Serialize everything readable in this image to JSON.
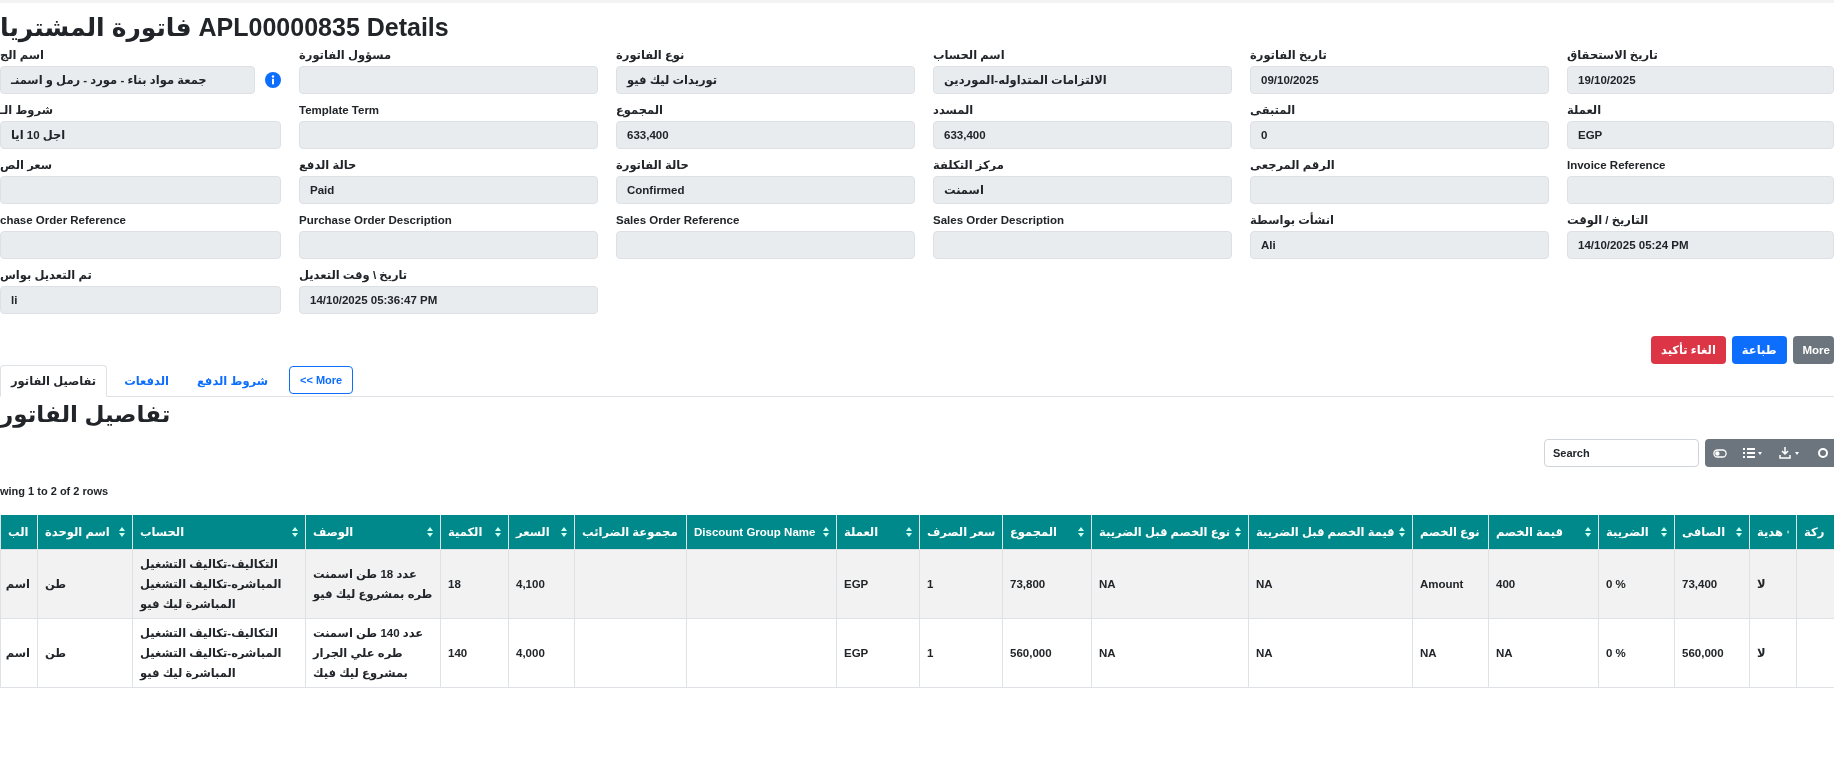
{
  "title": "فاتورة المشتريا APL00000835 Details",
  "form_rows": [
    [
      {
        "label": "تاريخ الاستحقاق",
        "value": "19/10/2025",
        "kind": "text"
      },
      {
        "label": "تاريخ الفاتورة",
        "value": "09/10/2025",
        "kind": "text"
      },
      {
        "label": "اسم الحساب",
        "value": "الالتزامات المتداوله-الموردين",
        "kind": "text"
      },
      {
        "label": "نوع الفاتورة",
        "value": "توريدات ليك فيو",
        "kind": "text"
      },
      {
        "label": "مسؤول الفاتورة",
        "kind": "text"
      },
      {
        "label": "اسم الج",
        "value": "جمعة مواد بناء - مورد - رمل و اسمنـ",
        "kind": "info"
      }
    ],
    [
      {
        "label": "العملة",
        "value": "EGP",
        "kind": "text"
      },
      {
        "label": "المتبقى",
        "value": "0",
        "kind": "text"
      },
      {
        "label": "المسدد",
        "value": "633,400",
        "kind": "text"
      },
      {
        "label": "المجموع",
        "value": "633,400",
        "kind": "text"
      },
      {
        "label": "Template Term",
        "kind": "text"
      },
      {
        "label": "شروط الـ",
        "value": "اجل 10 ايا",
        "kind": "text"
      }
    ],
    [
      {
        "label": "Invoice Reference",
        "kind": "text"
      },
      {
        "label": "الرقم المرجعى",
        "kind": "text"
      },
      {
        "label": "مركز التكلفة",
        "value": "اسمنت",
        "kind": "text"
      },
      {
        "label": "حالة الفاتورة",
        "value": "Confirmed",
        "kind": "text"
      },
      {
        "label": "حالة الدفع",
        "value": "Paid",
        "kind": "text"
      },
      {
        "label": "سعر الص",
        "kind": "text"
      }
    ],
    [
      {
        "label": "التاريخ / الوقت",
        "value": "14/10/2025 05:24 PM",
        "kind": "text"
      },
      {
        "label": "انشأت بواسطة",
        "value": "Ali",
        "kind": "text"
      },
      {
        "label": "Sales Order Description",
        "kind": "text"
      },
      {
        "label": "Sales Order Reference",
        "kind": "text"
      },
      {
        "label": "Purchase Order Description",
        "kind": "text"
      },
      {
        "label": "chase Order Reference",
        "kind": "text"
      }
    ],
    [
      {
        "label": "تاريخ \\ وقت التعديل",
        "value": "14/10/2025 05:36:47 PM",
        "kind": "text"
      },
      {
        "label": "تم التعديل بواس",
        "value": "li",
        "kind": "text"
      }
    ]
  ],
  "actions": [
    {
      "label": "More",
      "kind": "secondary"
    },
    {
      "label": "طباعة",
      "kind": "primary"
    },
    {
      "label": "الغاء تأكيد",
      "kind": "danger"
    }
  ],
  "tabs": [
    {
      "label": "More >>",
      "kind": "more",
      "selected": false
    },
    {
      "label": "شروط الدفع",
      "kind": "tab",
      "selected": false
    },
    {
      "label": "الدفعات",
      "kind": "tab",
      "selected": false
    },
    {
      "label": "تفاصيل الفاتور",
      "kind": "tab",
      "selected": true
    }
  ],
  "section_heading": "تفاصيل الفاتور",
  "search": {
    "placeholder": "Search"
  },
  "rows_info": "wing 1 to 2 of 2 rows",
  "table": {
    "columns": [
      "ركة",
      "هدية",
      "الصافى",
      "الضريبة",
      "قيمة الخصم",
      "نوع الخصم",
      "قيمة الخصم قبل الضريبة",
      "نوع الخصم قبل الضريبة",
      "المجموع",
      "سعر الصرف",
      "العملة",
      "Discount Group Name",
      "مجموعة الضرائب",
      "السعر",
      "الكمية",
      "الوصف",
      "الحساب",
      "اسم الوحدة",
      "الب"
    ],
    "rows": [
      [
        null,
        "لا",
        "73,400",
        "0 %",
        "400",
        "Amount",
        "NA",
        "NA",
        "73,800",
        "1",
        "EGP",
        null,
        null,
        "4,100",
        "18",
        "عدد 18 طن اسمنت طره بمشروع ليك فيو",
        "التكاليف-تكاليف التشغيل المباشره-تكاليف التشغيل المباشرة ليك فيو",
        "طن",
        "اسم"
      ],
      [
        null,
        "لا",
        "560,000",
        "0 %",
        "NA",
        "NA",
        "NA",
        "NA",
        "560,000",
        "1",
        "EGP",
        null,
        null,
        "4,000",
        "140",
        "عدد 140 طن اسمنت طره علي الجرار بمشروع ليك فيك",
        "التكاليف-تكاليف التشغيل المباشره-تكاليف التشغيل المباشرة ليك فيو",
        "طن",
        "اسم"
      ]
    ]
  }
}
